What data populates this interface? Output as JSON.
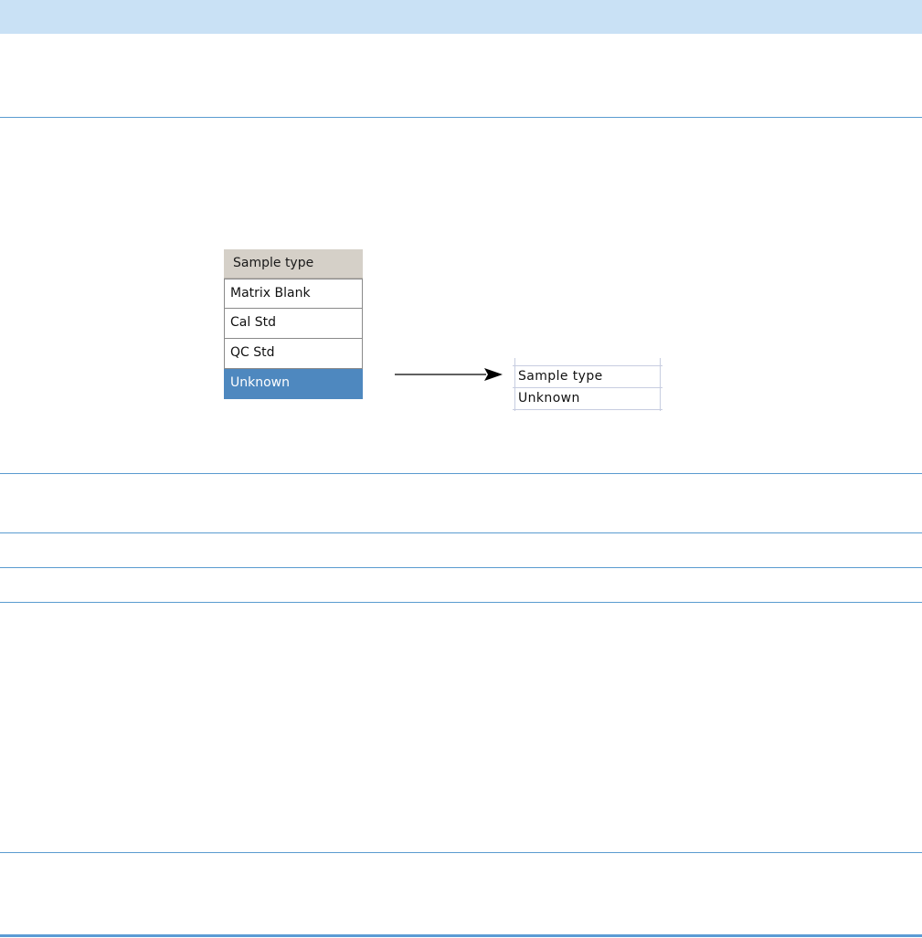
{
  "dropdown": {
    "header": "Sample type",
    "options": [
      {
        "label": "Matrix Blank",
        "selected": false
      },
      {
        "label": "Cal Std",
        "selected": false
      },
      {
        "label": "QC Std",
        "selected": false
      },
      {
        "label": "Unknown",
        "selected": true
      }
    ],
    "selected_color": "#4e88bf"
  },
  "result_table": {
    "header": "Sample type",
    "value": "Unknown"
  },
  "colors": {
    "header_band": "#c9e1f5",
    "rule": "#5a9bd0"
  }
}
